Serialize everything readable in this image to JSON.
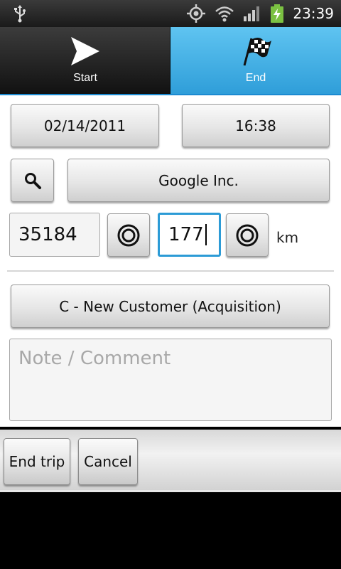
{
  "status_bar": {
    "time": "23:39",
    "icons": [
      "usb-icon",
      "gps-icon",
      "wifi-icon",
      "signal-icon",
      "battery-charging-icon"
    ],
    "accent": "#2f9ed9"
  },
  "tabs": [
    {
      "label": "Start",
      "icon": "arrow-icon",
      "selected": false
    },
    {
      "label": "End",
      "icon": "checkered-flag-icon",
      "selected": true
    }
  ],
  "form": {
    "date": "02/14/2011",
    "time": "16:38",
    "location": "Google Inc.",
    "odometer_start": "35184",
    "odometer_end": "177",
    "unit": "km",
    "category": "C - New Customer (Acquisition)",
    "note_placeholder": "Note / Comment"
  },
  "actions": {
    "end_trip": "End trip",
    "cancel": "Cancel"
  }
}
